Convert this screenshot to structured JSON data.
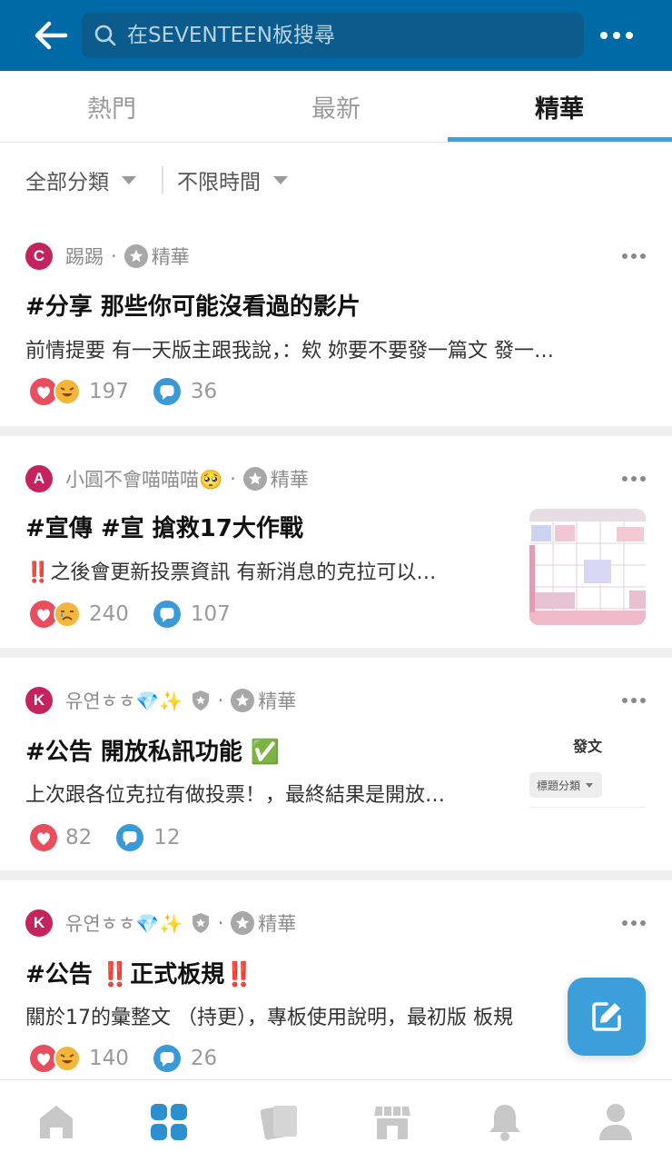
{
  "header": {
    "search_placeholder": "在SEVENTEEN板搜尋",
    "back_icon": "arrow-left-icon",
    "more_icon": "more-horizontal-icon"
  },
  "tabs": [
    {
      "label": "熱門",
      "active": false
    },
    {
      "label": "最新",
      "active": false
    },
    {
      "label": "精華",
      "active": true
    }
  ],
  "filters": {
    "category": "全部分類",
    "time": "不限時間"
  },
  "posts": [
    {
      "avatar_letter": "C",
      "author": "踢踢",
      "tag": "精華",
      "title": "#分享 那些你可能沒看過的影片",
      "excerpt": "前情提要 有一天版主跟我說，：欸 妳要不要發一篇文 發一…",
      "likes": "197",
      "comments": "36"
    },
    {
      "avatar_letter": "A",
      "author": "小圓不會喵喵喵🥺",
      "tag": "精華",
      "title": "#宣傳 #宣 搶救17大作戰",
      "excerpt": "‼️之後會更新投票資訊 有新消息的克拉可以…",
      "likes": "240",
      "comments": "107"
    },
    {
      "avatar_letter": "K",
      "author": "유연ㅎㅎ💎✨",
      "tag": "精華",
      "title": "#公告 開放私訊功能 ✅",
      "excerpt": "上次跟各位克拉有做投票！，最終結果是開放…",
      "likes": "82",
      "comments": "12",
      "thumb_title": "發文",
      "thumb_label": "標題分類"
    },
    {
      "avatar_letter": "K",
      "author": "유연ㅎㅎ💎✨",
      "tag": "精華",
      "title": "#公告 ‼️正式板規‼️",
      "excerpt": "關於17的彙整文 （持更），專板使用說明，最初版 板規",
      "likes": "140",
      "comments": "26"
    }
  ],
  "colors": {
    "header_bg": "#006aa6",
    "accent": "#3aa2dc",
    "avatar": "#c4245b",
    "fab": "#3d9fd9"
  },
  "bottom_nav": [
    "home-icon",
    "boards-grid-icon",
    "cards-icon",
    "store-icon",
    "bell-icon",
    "profile-icon"
  ]
}
